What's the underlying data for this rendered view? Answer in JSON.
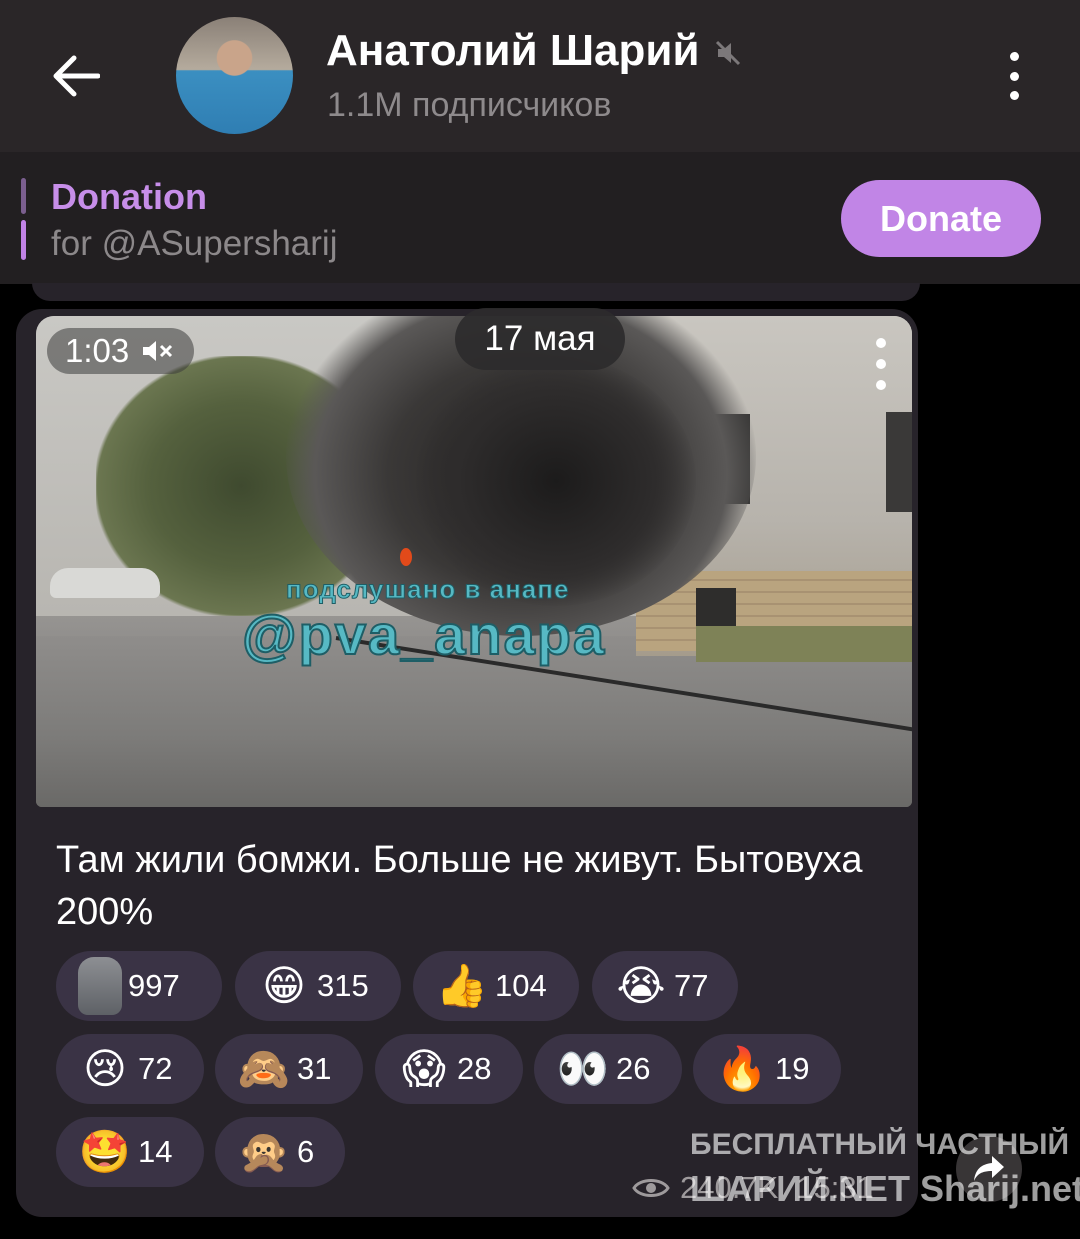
{
  "header": {
    "title": "Анатолий Шарий",
    "subscribers": "1.1M подписчиков",
    "icons": {
      "back": "back-arrow-icon",
      "mute": "muted-icon",
      "menu": "more-vertical-icon"
    }
  },
  "pinned": {
    "title": "Donation",
    "subtitle": "for @ASupersharij",
    "button_label": "Donate",
    "accent_color": "#c185e6"
  },
  "message": {
    "date": "17 мая",
    "video": {
      "duration": "1:03",
      "watermark_line1": "подслушано в анапе",
      "watermark_line2": "@pva_anapa"
    },
    "text": "Там жили бомжи. Больше не живут. Бытовуха 200%",
    "reactions": [
      {
        "emoji": "🗿",
        "icon": "moai-icon",
        "count": "997"
      },
      {
        "emoji": "😁",
        "icon": "grinning-face-icon",
        "count": "315"
      },
      {
        "emoji": "👍",
        "icon": "thumbs-up-icon",
        "count": "104"
      },
      {
        "emoji": "😭",
        "icon": "crying-face-icon",
        "count": "77"
      },
      {
        "emoji": "😢",
        "icon": "sad-tear-face-icon",
        "count": "72"
      },
      {
        "emoji": "🙈",
        "icon": "see-no-evil-monkey-icon",
        "count": "31"
      },
      {
        "emoji": "😱",
        "icon": "screaming-face-icon",
        "count": "28"
      },
      {
        "emoji": "👀",
        "icon": "eyes-icon",
        "count": "26"
      },
      {
        "emoji": "🔥",
        "icon": "fire-icon",
        "count": "19"
      },
      {
        "emoji": "🤩",
        "icon": "star-struck-icon",
        "count": "14"
      },
      {
        "emoji": "🙊",
        "icon": "speak-no-evil-monkey-icon",
        "count": "6"
      }
    ],
    "views": "240.7K",
    "time": "15:31"
  },
  "overlay_watermark": {
    "line1": "БЕСПЛАТНЫЙ ЧАСТНЫЙ",
    "line2": "ШАРИЙ.NET  Sharij.net"
  }
}
